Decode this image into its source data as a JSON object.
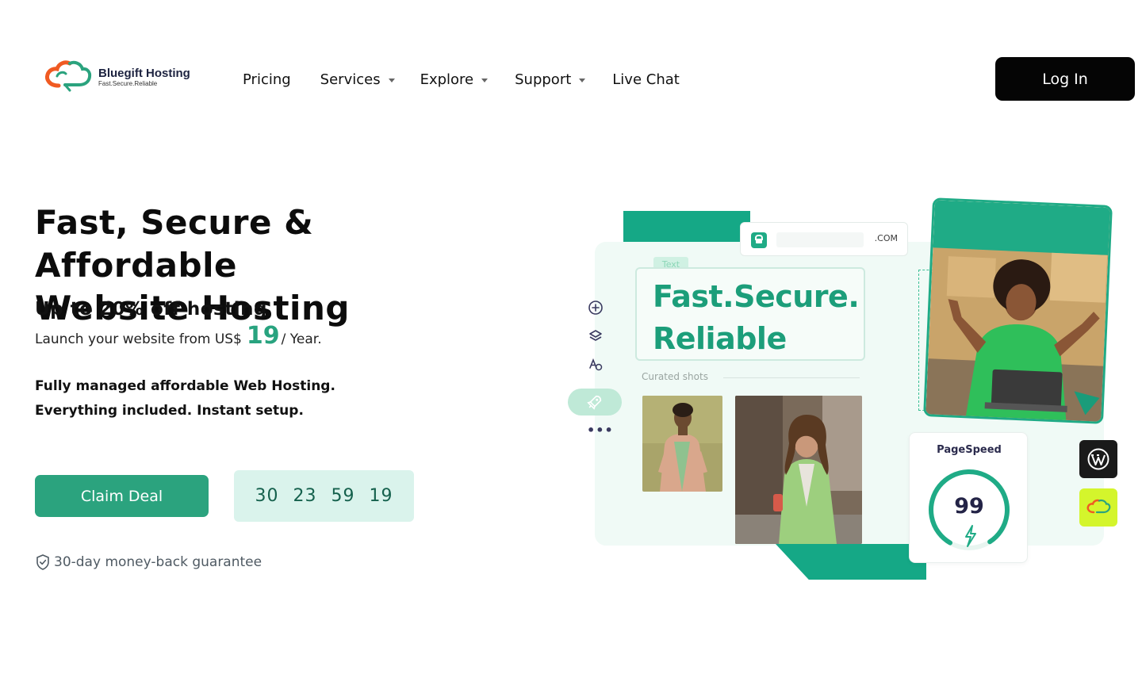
{
  "brand": {
    "name": "Bluegift Hosting",
    "tagline": "Fast.Secure.Reliable",
    "colors": {
      "orange": "#f05a22",
      "green": "#2ba37e",
      "navy": "#1d2340"
    }
  },
  "nav": {
    "items": [
      {
        "label": "Pricing",
        "has_dropdown": false
      },
      {
        "label": "Services",
        "has_dropdown": true
      },
      {
        "label": "Explore",
        "has_dropdown": true
      },
      {
        "label": "Support",
        "has_dropdown": true
      },
      {
        "label": "Live Chat",
        "has_dropdown": false
      }
    ],
    "login_label": "Log In"
  },
  "hero": {
    "title_line1": "Fast, Secure & Affordable",
    "title_line2": "Website Hosting",
    "discount": "Up to 20% off hosting",
    "launch_prefix": "Launch your website from US$",
    "launch_price": "19",
    "launch_suffix": "/ Year.",
    "managed_line1": "Fully managed affordable Web Hosting.",
    "managed_line2": "Everything included. Instant setup.",
    "cta_label": "Claim Deal",
    "countdown": [
      "30",
      "23",
      "59",
      "19"
    ],
    "guarantee": "30-day money-back guarantee"
  },
  "illustration": {
    "domain_suffix": ".COM",
    "text_tag": "Text",
    "headline_line1": "Fast.Secure.",
    "headline_line2": "Reliable",
    "curated_label": "Curated shots",
    "pagespeed_label": "PageSpeed",
    "pagespeed_value": "99",
    "pagespeed_fraction": 0.99,
    "toolbar_icons": [
      "add-icon",
      "layers-icon",
      "font-style-icon",
      "rocket-icon",
      "more-icon"
    ],
    "badges": [
      "wordpress-icon",
      "bluegift-cloud-icon"
    ],
    "accent_color": "#15a886",
    "badge_lime": "#d4f52c"
  }
}
